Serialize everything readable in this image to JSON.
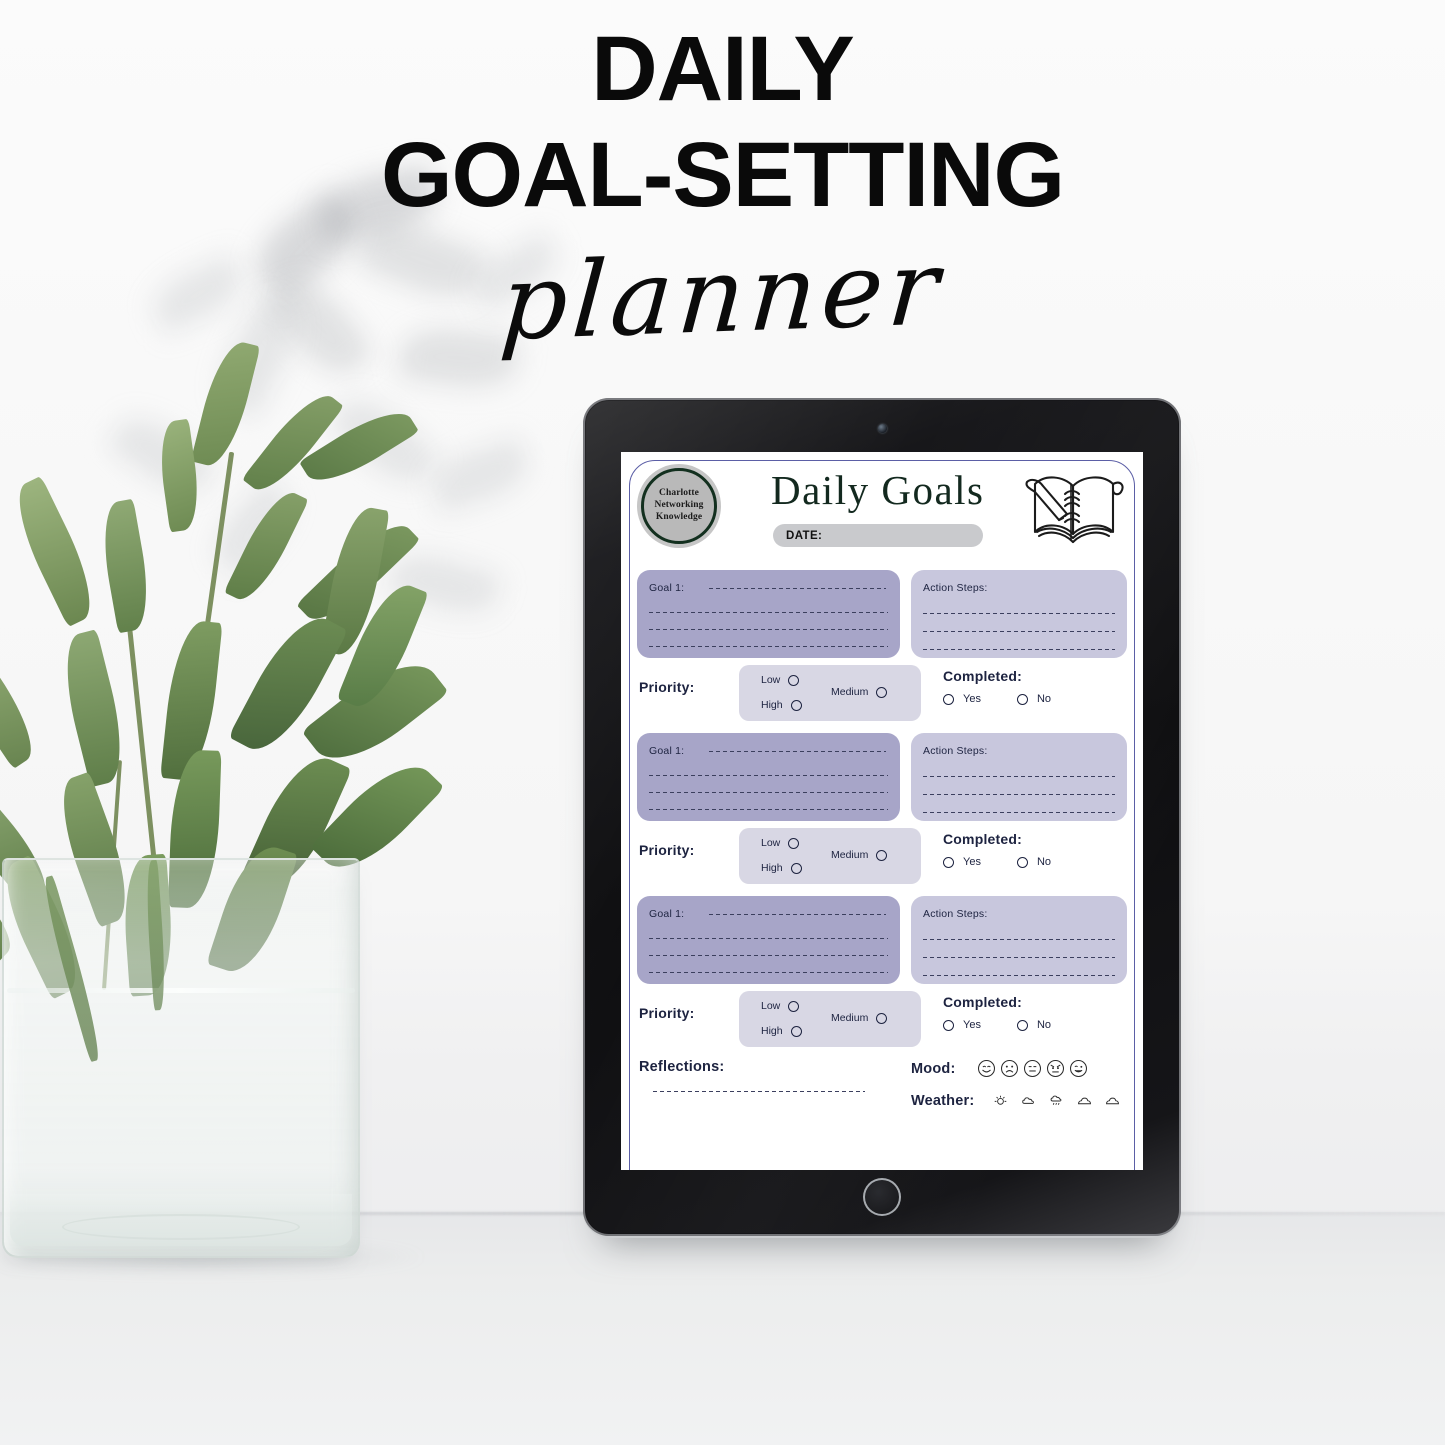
{
  "poster": {
    "title_line1": "DAILY",
    "title_line2": "GOAL-SETTING",
    "script_word": "planner"
  },
  "device": {
    "name": "tablet",
    "camera_icon": "camera-dot-icon",
    "home_button_icon": "home-button-icon"
  },
  "worksheet": {
    "logo": {
      "line1": "Charlotte",
      "line2": "Networking",
      "line3": "Knowledge"
    },
    "title": "Daily Goals",
    "book_icon": "open-notebook-pen-icon",
    "date_label": "DATE:",
    "date_value": "",
    "goal_block_labels": {
      "goal": "Goal 1:",
      "action": "Action Steps:",
      "priority": "Priority:",
      "completed": "Completed:"
    },
    "priority_options": [
      "Low",
      "Medium",
      "High"
    ],
    "completed_options": [
      "Yes",
      "No"
    ],
    "goals": [
      {
        "goal_label": "Goal 1:",
        "action_label": "Action Steps:",
        "goal_value": "",
        "action_value": ""
      },
      {
        "goal_label": "Goal 1:",
        "action_label": "Action Steps:",
        "goal_value": "",
        "action_value": ""
      },
      {
        "goal_label": "Goal 1:",
        "action_label": "Action Steps:",
        "goal_value": "",
        "action_value": ""
      }
    ],
    "footer": {
      "reflections_label": "Reflections:",
      "mood_label": "Mood:",
      "weather_label": "Weather:",
      "mood_faces": [
        "happy-face-icon",
        "sad-face-icon",
        "neutral-face-icon",
        "angry-face-icon",
        "silly-face-icon"
      ],
      "weather_icons": [
        "sun-icon",
        "cloud-icon",
        "rain-icon",
        "cloudy-icon",
        "cloudy-icon"
      ]
    }
  },
  "colors": {
    "goal_box": "#a7a5c8",
    "action_box": "#c8c7dd",
    "priority_box": "#d8d7e4",
    "page_border": "#5b5ea6",
    "title_ink": "#13291f",
    "text_ink": "#1d2340",
    "date_pill": "#c9cacd",
    "logo_ring": "#13301f",
    "logo_fill": "#b9b9b9",
    "leaf_green": "#6f8b4e",
    "background": "#f6f6f6"
  }
}
